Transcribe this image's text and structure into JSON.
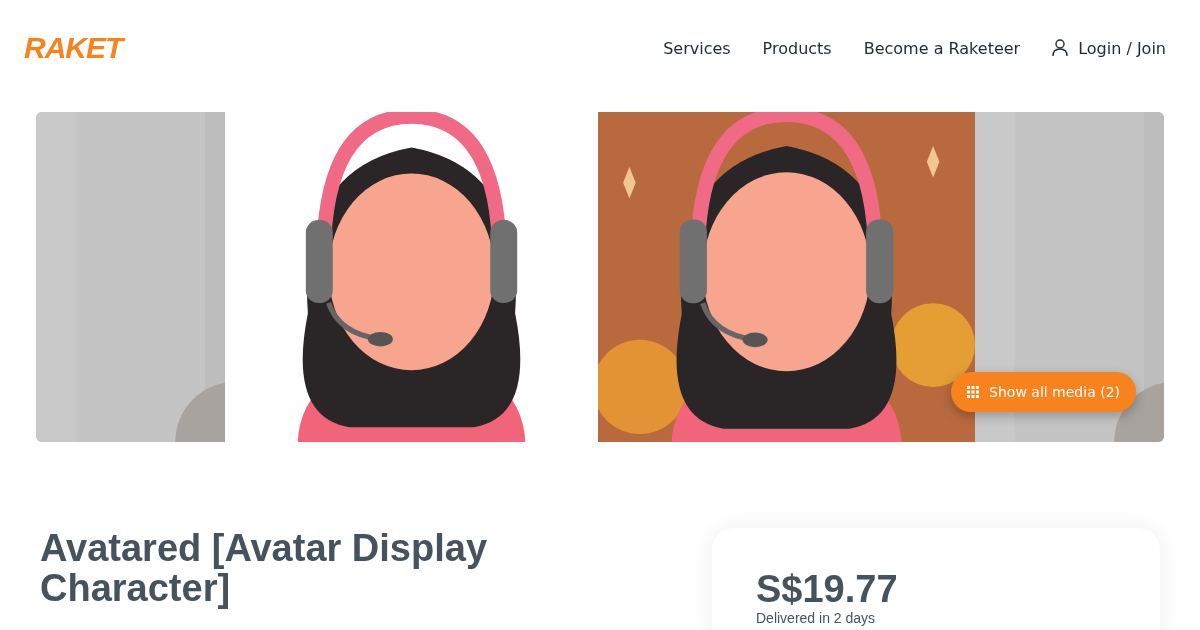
{
  "header": {
    "logo": "RAKET",
    "nav": [
      {
        "label": "Services"
      },
      {
        "label": "Products"
      },
      {
        "label": "Become a Raketeer"
      }
    ],
    "login": "Login / Join"
  },
  "gallery": {
    "show_all": "Show all media (2)"
  },
  "product": {
    "title": "Avatared [Avatar Display Character]",
    "price": "S$19.77",
    "delivery": "Delivered in 2 days"
  }
}
